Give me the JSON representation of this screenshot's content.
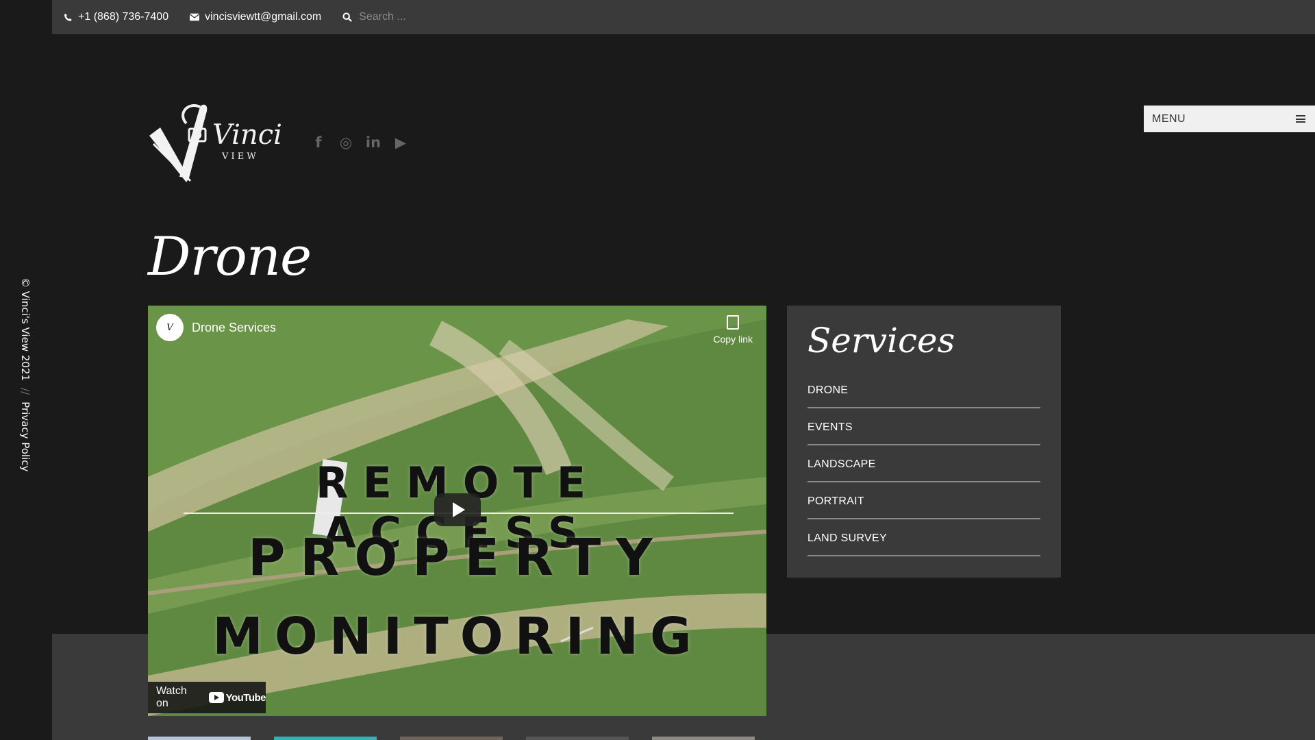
{
  "topbar": {
    "phone": "+1 (868) 736-7400",
    "email": "vincisviewtt@gmail.com",
    "search_placeholder": "Search ..."
  },
  "sidebar": {
    "copyright": "© Vinci's View 2021",
    "separator": "//",
    "privacy": "Privacy Policy"
  },
  "logo": {
    "name": "Vinci's",
    "tagline": "V I E W"
  },
  "social": [
    {
      "icon": "facebook-icon",
      "glyph": "f"
    },
    {
      "icon": "instagram-icon",
      "glyph": "◎"
    },
    {
      "icon": "linkedin-icon",
      "glyph": "in"
    },
    {
      "icon": "youtube-icon",
      "glyph": "▶"
    }
  ],
  "menu": {
    "label": "MENU"
  },
  "page": {
    "title": "Drone"
  },
  "video": {
    "channel_title": "Drone Services",
    "copy_link": "Copy link",
    "overlay_line1": "REMOTE ACCESS",
    "overlay_line2": "PROPERTY",
    "overlay_line3": "MONITORING",
    "watch_on": "Watch on",
    "youtube": "YouTube"
  },
  "services": {
    "heading": "Services",
    "items": [
      "DRONE",
      "EVENTS",
      "LANDSCAPE",
      "PORTRAIT",
      "LAND SURVEY"
    ]
  },
  "colors": {
    "background": "#1a1a1a",
    "topbar": "#3a3a3a",
    "panel": "#3a3a3a",
    "menu_button": "#f0f0f0"
  }
}
